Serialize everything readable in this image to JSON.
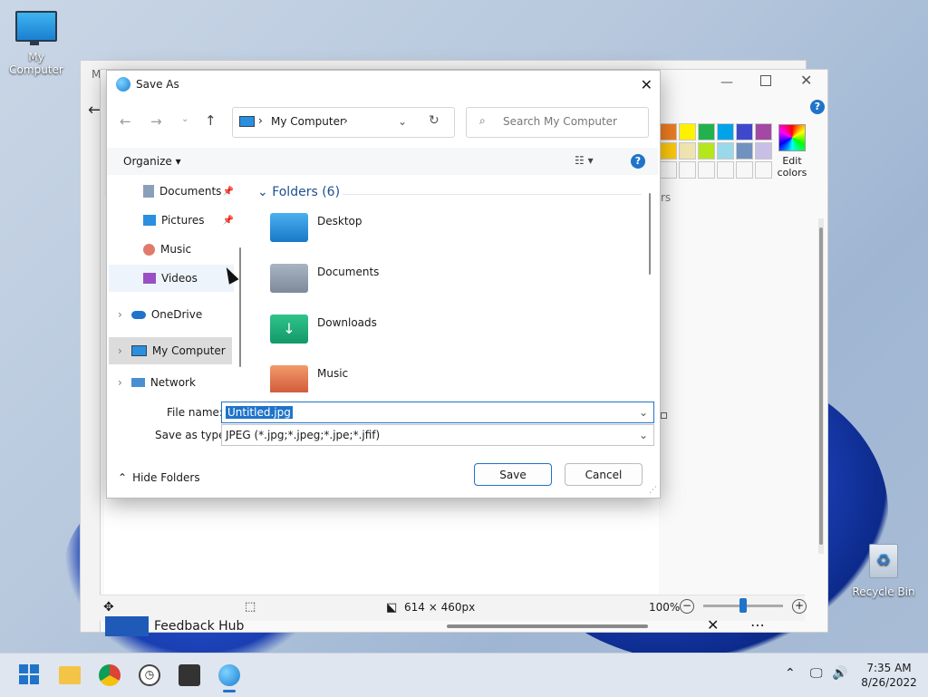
{
  "desktop": {
    "icons": [
      {
        "label": "My Computer"
      },
      {
        "label": "Recycle Bin"
      }
    ]
  },
  "paint_window": {
    "title_partial": "M",
    "edit_colors_label": "Edit colors",
    "colors_partial": "rs",
    "status": {
      "dimensions": "614 × 460px",
      "zoom": "100%"
    },
    "palette": [
      "#ef7d22",
      "#fff200",
      "#22b14c",
      "#00a2e8",
      "#3f48cc",
      "#a349a4",
      "#ffc90e",
      "#efe4b0",
      "#b5e61d",
      "#99d9ea",
      "#7092be",
      "#c8bfe7"
    ]
  },
  "feedback_hub": {
    "label": "Feedback Hub"
  },
  "dialog": {
    "title": "Save As",
    "address": {
      "location": "My Computer"
    },
    "search": {
      "placeholder": "Search My Computer"
    },
    "organize_label": "Organize",
    "nav": [
      {
        "label": "Documents",
        "pinned": true
      },
      {
        "label": "Pictures",
        "pinned": true
      },
      {
        "label": "Music"
      },
      {
        "label": "Videos"
      },
      {
        "label": "OneDrive"
      },
      {
        "label": "My Computer"
      },
      {
        "label": "Network"
      }
    ],
    "group_header": "Folders (6)",
    "folders": [
      {
        "label": "Desktop"
      },
      {
        "label": "Documents"
      },
      {
        "label": "Downloads"
      },
      {
        "label": "Music"
      }
    ],
    "file_name_label": "File name:",
    "file_name_value": "Untitled.jpg",
    "save_type_label": "Save as type:",
    "save_type_value": "JPEG (*.jpg;*.jpeg;*.jpe;*.jfif)",
    "hide_folders_label": "Hide Folders",
    "save_label": "Save",
    "cancel_label": "Cancel"
  },
  "taskbar": {
    "time": "7:35 AM",
    "date": "8/26/2022"
  }
}
